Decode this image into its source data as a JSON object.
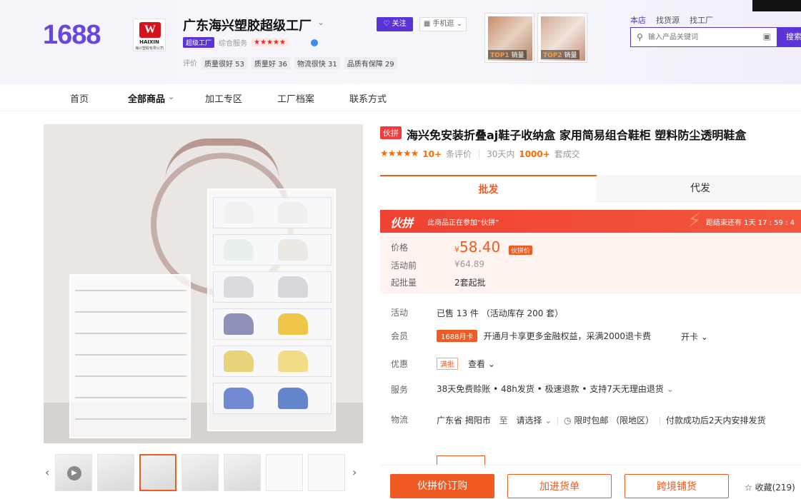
{
  "header": {
    "logo": "1688",
    "shop_logo_text": "W",
    "shop_logo_en": "HAIXIN",
    "shop_logo_cn": "海兴塑胶有限公司",
    "shop_name": "广东海兴塑胶超级工厂",
    "factory_badge": "超级工厂",
    "composite_label": "综合服务",
    "composite_stars": "★★★★★",
    "review_label": "评价",
    "review_tags": [
      "质量很好 53",
      "质量好 36",
      "物流很快 31",
      "品质有保障 29"
    ],
    "follow_label": "关注",
    "mobile_label": "手机逛",
    "top_items": [
      {
        "rank": "TOP1",
        "label": "销量"
      },
      {
        "rank": "TOP2",
        "label": "销量"
      }
    ],
    "search_tabs": [
      "本店",
      "找货源",
      "找工厂"
    ],
    "search_placeholder": "输入产品关键词",
    "search_button": "搜索"
  },
  "nav": {
    "items": [
      "首页",
      "全部商品",
      "加工专区",
      "工厂档案",
      "联系方式"
    ]
  },
  "product": {
    "title_tag": "伙拼",
    "title": "海兴免安装折叠aj鞋子收纳盒 家用简易组合鞋柜 塑料防尘透明鞋盒",
    "rating_stars": "★★★★★",
    "review_count": "10+",
    "review_suffix": "条评价",
    "sold_prefix": "30天内",
    "sold_count": "1000+",
    "sold_suffix": "套成交",
    "tabs": [
      "批发",
      "代发"
    ],
    "promo": {
      "logo": "伙拼",
      "text": "此商品正在参加“伙拼”",
      "countdown": "距结束还有 1天 17 : 59 : 4"
    },
    "price_label": "价格",
    "price_currency": "¥",
    "price": "58.40",
    "price_tag": "伙拼价",
    "before_label": "活动前",
    "before_price": "¥64.89",
    "moq_label": "起批量",
    "moq": "2套起批",
    "activity_label": "活动",
    "activity": "已售 13 件 （活动库存 200 套）",
    "member_label": "会员",
    "member_badge": "1688月卡",
    "member_text": "开通月卡享更多金融权益，采满2000退卡费",
    "member_link": "开卡",
    "discount_label": "优惠",
    "discount_badge": "满批",
    "discount_link": "查看",
    "service_label": "服务",
    "service": "38天免费赊账 • 48h发货 • 极速退款 • 支持7天无理由退货",
    "logistics_label": "物流",
    "from": "广东省 揭阳市",
    "to_word": "至",
    "to_select": "请选择",
    "shipping": "限时包邮 （限地区）",
    "delivery": "付款成功后2天内安排发货",
    "buttons": {
      "order": "伙拼价订购",
      "cart": "加进货单",
      "cross": "跨境铺货",
      "fav": "收藏(219)"
    }
  }
}
